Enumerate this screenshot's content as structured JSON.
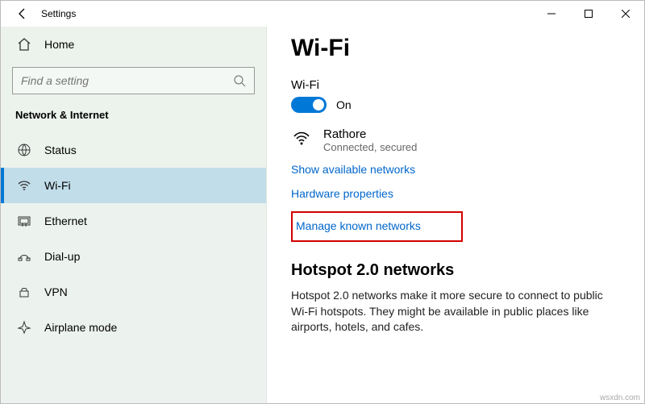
{
  "titlebar": {
    "title": "Settings"
  },
  "sidebar": {
    "home": "Home",
    "search_placeholder": "Find a setting",
    "section": "Network & Internet",
    "items": [
      {
        "label": "Status"
      },
      {
        "label": "Wi-Fi"
      },
      {
        "label": "Ethernet"
      },
      {
        "label": "Dial-up"
      },
      {
        "label": "VPN"
      },
      {
        "label": "Airplane mode"
      }
    ]
  },
  "main": {
    "heading": "Wi-Fi",
    "wifi_label": "Wi-Fi",
    "toggle_state": "On",
    "connection": {
      "name": "Rathore",
      "status": "Connected, secured"
    },
    "links": {
      "available": "Show available networks",
      "hardware": "Hardware properties",
      "manage": "Manage known networks"
    },
    "hotspot": {
      "heading": "Hotspot 2.0 networks",
      "desc": "Hotspot 2.0 networks make it more secure to connect to public Wi-Fi hotspots. They might be available in public places like airports, hotels, and cafes."
    }
  },
  "watermark": "wsxdn.com"
}
